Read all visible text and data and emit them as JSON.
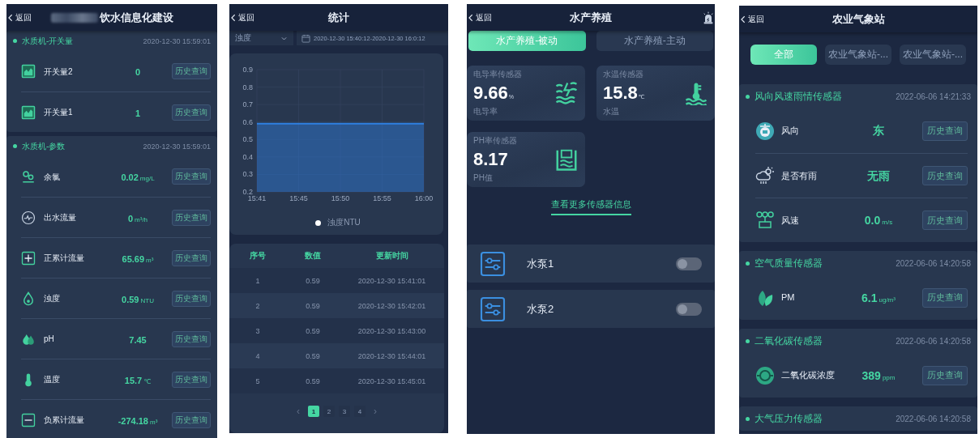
{
  "screens": [
    {
      "kind": "groups",
      "back": "返回",
      "title": "饮水信息化建设",
      "groups": [
        {
          "title": "水质机-开关量",
          "time": "2020-12-30 15:59:01",
          "rows": [
            {
              "name": "开关量2",
              "value": "0",
              "button": "历史查询"
            },
            {
              "name": "开关量1",
              "value": "1",
              "button": "历史查询"
            }
          ]
        },
        {
          "title": "水质机-参数",
          "time": "2020-12-30 15:59:01",
          "rows": [
            {
              "name": "余氯",
              "value": "0.02",
              "unit": "mg/L",
              "button": "历史查询"
            },
            {
              "name": "出水流量",
              "value": "0",
              "unit": "m³/h",
              "button": "历史查询"
            },
            {
              "name": "正累计流量",
              "value": "65.69",
              "unit": "m³",
              "button": "历史查询"
            },
            {
              "name": "浊度",
              "value": "0.59",
              "unit": "NTU",
              "button": "历史查询"
            },
            {
              "name": "pH",
              "value": "7.45",
              "button": "历史查询"
            },
            {
              "name": "温度",
              "value": "15.7",
              "unit": "℃",
              "button": "历史查询"
            },
            {
              "name": "负累计流量",
              "value": "-274.18",
              "unit": "m³",
              "button": "历史查询"
            }
          ]
        }
      ]
    },
    {
      "kind": "stats",
      "back": "返回",
      "title": "统计",
      "metric": "浊度",
      "date_range": "2020-12-30 15:40:12-2020-12-30 16:0:12",
      "chart_data": {
        "type": "area",
        "grid": true,
        "categories": [
          "15:41",
          "15:45",
          "15:50",
          "15:55",
          "16:00"
        ],
        "ylim": [
          0.2,
          0.9
        ],
        "yticks": [
          0.2,
          0.3,
          0.4,
          0.5,
          0.6,
          0.7,
          0.8,
          0.9
        ],
        "series": [
          {
            "name": "浊度NTU",
            "color": "#2f7fe0",
            "values": [
              0.59,
              0.59,
              0.59,
              0.59,
              0.59
            ]
          }
        ]
      },
      "table": {
        "columns": [
          "序号",
          "数值",
          "更新时间"
        ],
        "rows": [
          [
            "1",
            "0.59",
            "2020-12-30 15:41:01"
          ],
          [
            "2",
            "0.59",
            "2020-12-30 15:42:01"
          ],
          [
            "3",
            "0.59",
            "2020-12-30 15:43:00"
          ],
          [
            "4",
            "0.59",
            "2020-12-30 15:44:01"
          ],
          [
            "5",
            "0.59",
            "2020-12-30 15:45:01"
          ]
        ]
      },
      "pagination": {
        "prev": "‹",
        "next": "›",
        "pages": [
          {
            "label": "1",
            "selected": true
          },
          {
            "label": "2",
            "selected": false
          },
          {
            "label": "3",
            "selected": false
          },
          {
            "label": "4",
            "selected": false
          }
        ]
      }
    },
    {
      "kind": "aquaculture",
      "back": "返回",
      "title": "水产养殖",
      "tabs": [
        {
          "label": "水产养殖-被动",
          "selected": true
        },
        {
          "label": "水产养殖-主动",
          "selected": false
        }
      ],
      "sensors": [
        {
          "title": "电导率传感器",
          "value": "9.66",
          "unit": "%",
          "caption": "电导率"
        },
        {
          "title": "水温传感器",
          "value": "15.8",
          "unit": "℃",
          "caption": "水温"
        },
        {
          "title": "PH率传感器",
          "value": "8.17",
          "caption": "PH值"
        }
      ],
      "more_link": "查看更多传感器信息",
      "pumps": [
        {
          "name": "水泵1",
          "on": false
        },
        {
          "name": "水泵2",
          "on": false
        }
      ]
    },
    {
      "kind": "groups",
      "back": "返回",
      "title": "农业气象站",
      "tabs": [
        {
          "label": "全部",
          "selected": true
        },
        {
          "label": "农业气象站-...",
          "selected": false
        },
        {
          "label": "农业气象站-...",
          "selected": false
        }
      ],
      "groups": [
        {
          "title": "风向风速雨情传感器",
          "time": "2022-06-06 14:21:33",
          "rows": [
            {
              "name": "风向",
              "value": "东",
              "button": "历史查询"
            },
            {
              "name": "是否有雨",
              "value": "无雨",
              "button": "历史查询"
            },
            {
              "name": "风速",
              "value": "0.0",
              "unit": "m/s",
              "button": "历史查询"
            }
          ]
        },
        {
          "title": "空气质量传感器",
          "time": "2022-06-06 14:20:58",
          "rows": [
            {
              "name": "PM",
              "value": "6.1",
              "unit": "ug/m³",
              "button": "历史查询"
            }
          ]
        },
        {
          "title": "二氧化碳传感器",
          "time": "2022-06-06 14:20:58",
          "rows": [
            {
              "name": "二氧化碳浓度",
              "value": "389",
              "unit": "ppm",
              "button": "历史查询"
            }
          ]
        },
        {
          "title": "大气压力传感器",
          "time": "2022-06-06 14:20:58"
        }
      ]
    }
  ]
}
